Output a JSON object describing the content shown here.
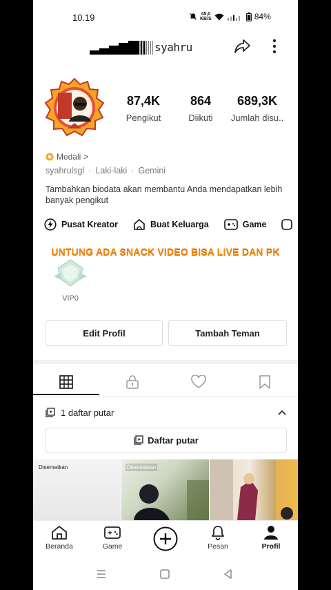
{
  "status_bar": {
    "time": "10.19",
    "speed_value": "45,0",
    "speed_unit": "KB/S",
    "battery": "84%"
  },
  "header": {
    "username": "syahru"
  },
  "stats": [
    {
      "value": "87,4K",
      "label": "Pengikut"
    },
    {
      "value": "864",
      "label": "Diikuti"
    },
    {
      "value": "689,3K",
      "label": "Jumlah disu.."
    }
  ],
  "profile": {
    "medal_label": "Medali",
    "medal_chevron": ">",
    "meta": [
      "syahrulsgl",
      "·",
      "Laki-laki",
      "·",
      "Gemini"
    ],
    "bio": "Tambahkan biodata akan membantu Anda mendapatkan lebih banyak pengikut"
  },
  "shortcuts": [
    {
      "label": "Pusat Kreator",
      "icon": "lightning-icon"
    },
    {
      "label": "Buat Keluarga",
      "icon": "family-house-icon"
    },
    {
      "label": "Game",
      "icon": "gamepad-icon"
    }
  ],
  "banner_text": "UNTUNG ADA SNACK VIDEO BISA LIVE DAN PK",
  "vip": {
    "label": "VIP0"
  },
  "buttons": {
    "edit_profile": "Edit Profil",
    "add_friend": "Tambah Teman"
  },
  "tabs": [
    {
      "icon": "grid-icon",
      "active": true
    },
    {
      "icon": "lock-icon",
      "active": false
    },
    {
      "icon": "heart-icon",
      "active": false
    },
    {
      "icon": "bookmark-icon",
      "active": false
    }
  ],
  "playlist": {
    "count_label": "1 daftar putar",
    "button_label": "Daftar putar"
  },
  "thumbnails": [
    {
      "pinned_label": "Disematkan"
    },
    {
      "pinned_label": "Disematkan"
    },
    {
      "pinned_label": ""
    }
  ],
  "bottom_nav": [
    {
      "label": "Beranda",
      "icon": "home-icon"
    },
    {
      "label": "Game",
      "icon": "gamepad-icon"
    },
    {
      "label": "",
      "icon": "plus-circle-icon"
    },
    {
      "label": "Pesan",
      "icon": "bell-icon"
    },
    {
      "label": "Profil",
      "icon": "person-icon",
      "active": true
    }
  ],
  "colors": {
    "banner": "#f28a18",
    "text_primary": "#111111",
    "text_secondary": "#777777",
    "medal": "#f5a623"
  }
}
